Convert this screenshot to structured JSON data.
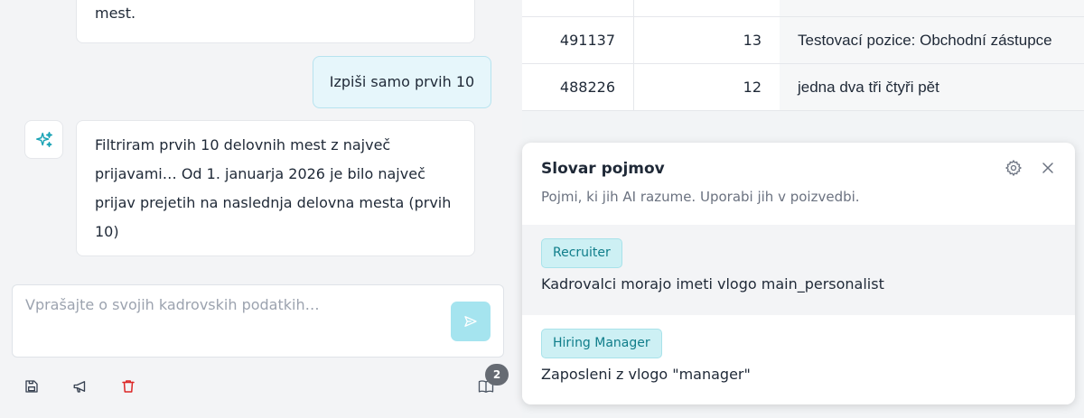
{
  "chat": {
    "prev_message_tail": "mest.",
    "user_message": "Izpiši samo prvih 10",
    "ai_message": "Filtriram prvih 10 delovnih mest z največ prijavami… Od 1. januarja 2026 je bilo največ prijav prejetih na naslednja delovna mesta (prvih 10)",
    "composer_placeholder": "Vprašajte o svojih kadrovskih podatkih…",
    "badge_count": "2"
  },
  "table": {
    "rows": [
      {
        "id": "491137",
        "count": "13",
        "title": "Testovací pozice: Obchodní zástupce"
      },
      {
        "id": "488226",
        "count": "12",
        "title": "jedna dva tři čtyři pět"
      }
    ]
  },
  "glossary": {
    "title": "Slovar pojmov",
    "subtitle": "Pojmi, ki jih AI razume. Uporabi jih v poizvedbi.",
    "terms": [
      {
        "label": "Recruiter",
        "description": "Kadrovalci morajo imeti vlogo main_personalist"
      },
      {
        "label": "Hiring Manager",
        "description": "Zaposleni z vlogo \"manager\""
      }
    ]
  },
  "colors": {
    "accent": "#0f7d8a",
    "pill_bg": "#cdf0f4",
    "send_button": "#a5e4ef",
    "delete_icon": "#dc2626"
  },
  "icons": [
    "sparkles-icon",
    "send-icon",
    "save-icon",
    "megaphone-icon",
    "trash-icon",
    "book-icon",
    "gear-icon",
    "close-icon"
  ]
}
